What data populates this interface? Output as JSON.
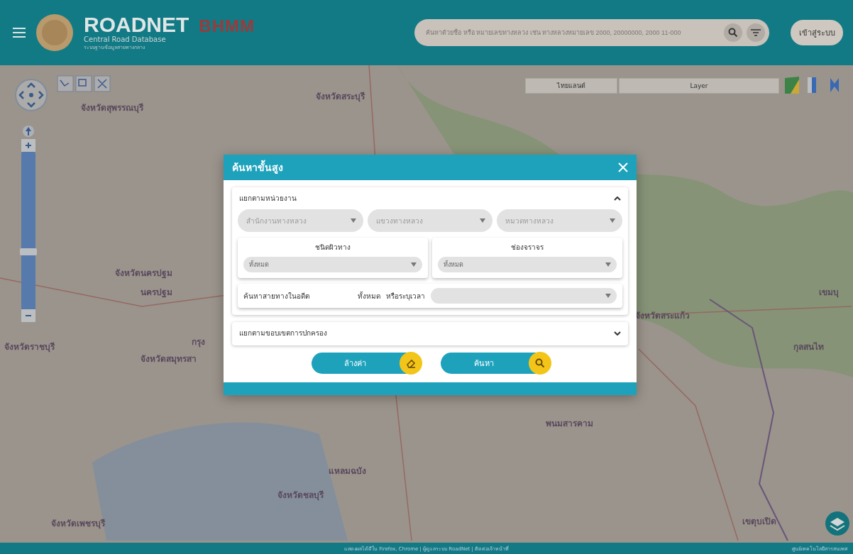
{
  "header": {
    "brand": "ROADNET",
    "tagline": "Central Road Database",
    "subtitle": "ระบบฐานข้อมูลสายทางกลาง",
    "partner": "BHMM",
    "search": {
      "placeholder": "ค้นหาด้วยชื่อ หรือ หมายเลขทางหลวง เช่น ทางหลวงหมายเลข 2000, 20000000, 2000 11-000"
    },
    "login": "เข้าสู่ระบบ"
  },
  "map": {
    "labels": [
      {
        "text": "จังหวัดสระบุรี"
      },
      {
        "text": "จังหวัดสุพรรณบุรี"
      },
      {
        "text": "จังหวัดนครปฐม"
      },
      {
        "text": "นครปฐม"
      },
      {
        "text": "เขมบุ"
      },
      {
        "text": "จังหวัดสระแก้ว"
      },
      {
        "text": "จังหวัดราชบุรี"
      },
      {
        "text": "กรุง"
      },
      {
        "text": "กุลสนไท"
      },
      {
        "text": "จังหวัดสมุทรสา"
      },
      {
        "text": "พนมสารคาม"
      },
      {
        "text": "แหลมฉบัง"
      },
      {
        "text": "จังหวัดชลบุรี"
      },
      {
        "text": "จังหวัดเพชรบุรี"
      },
      {
        "text": "เขตุบเปิด"
      }
    ],
    "basemap": "ไทยแลนด์",
    "layer": "Layer",
    "zoom": {
      "level": 0.4
    }
  },
  "dialog": {
    "title": "ค้นหาขั้นสูง",
    "sections": [
      {
        "title": "แยกตามหน่วยงาน",
        "expanded": true,
        "selects": [
          "สำนักงานทางหลวง",
          "แขวงทางหลวง",
          "หมวดทางหลวง"
        ],
        "cards": [
          {
            "title": "ชนิดผิวทาง",
            "value": "ทั้งหมด"
          },
          {
            "title": "ช่องจราจร",
            "value": "ทั้งหมด"
          }
        ],
        "history": {
          "label": "ค้นหาสายทางในอดีต",
          "all": "ทั้งหมด",
          "or": "หรือระบุเวลา"
        }
      },
      {
        "title": "แยกตามขอบเขตการปกครอง",
        "expanded": false
      }
    ],
    "buttons": [
      {
        "label": "ล้างค่า",
        "kind": "clear"
      },
      {
        "label": "ค้นหา",
        "kind": "search"
      }
    ]
  },
  "footer": {
    "center": "แสดงผลได้ดีใน Firefox, Chrome | ผู้ดูแลระบบ RoadNet | ติดต่อเจ้าหน้าที่",
    "right": "ศูนย์เทคโนโลยีสารสนเทศ"
  }
}
